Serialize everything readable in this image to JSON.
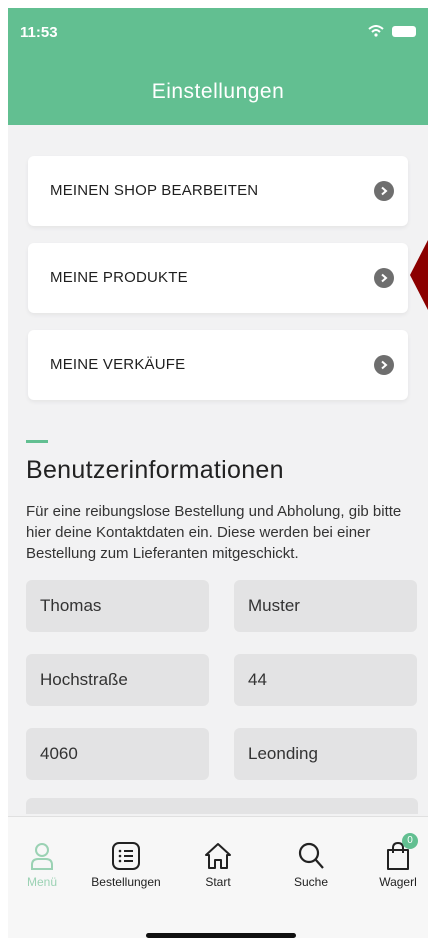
{
  "status": {
    "time": "11:53"
  },
  "header": {
    "title": "Einstellungen"
  },
  "menu": {
    "items": [
      {
        "label": "MEINEN SHOP BEARBEITEN"
      },
      {
        "label": "MEINE PRODUKTE"
      },
      {
        "label": "MEINE VERKÄUFE"
      }
    ]
  },
  "section": {
    "title": "Benutzerinformationen",
    "description": "Für eine reibungslose Bestellung und Abholung, gib bitte hier deine Kontaktdaten ein. Diese werden bei einer Bestellung zum Lieferanten mitgeschickt."
  },
  "fields": {
    "first_name": "Thomas",
    "last_name": "Muster",
    "street": "Hochstraße",
    "house_number": "44",
    "zip": "4060",
    "city": "Leonding"
  },
  "tabbar": {
    "items": [
      {
        "label": "Menü",
        "icon": "person-icon",
        "active": true
      },
      {
        "label": "Bestellungen",
        "icon": "list-icon"
      },
      {
        "label": "Start",
        "icon": "home-icon"
      },
      {
        "label": "Suche",
        "icon": "search-icon"
      },
      {
        "label": "Wagerl",
        "icon": "bag-icon",
        "badge": "0"
      }
    ]
  },
  "colors": {
    "accent": "#62bf91",
    "pointer": "#8b0000"
  }
}
